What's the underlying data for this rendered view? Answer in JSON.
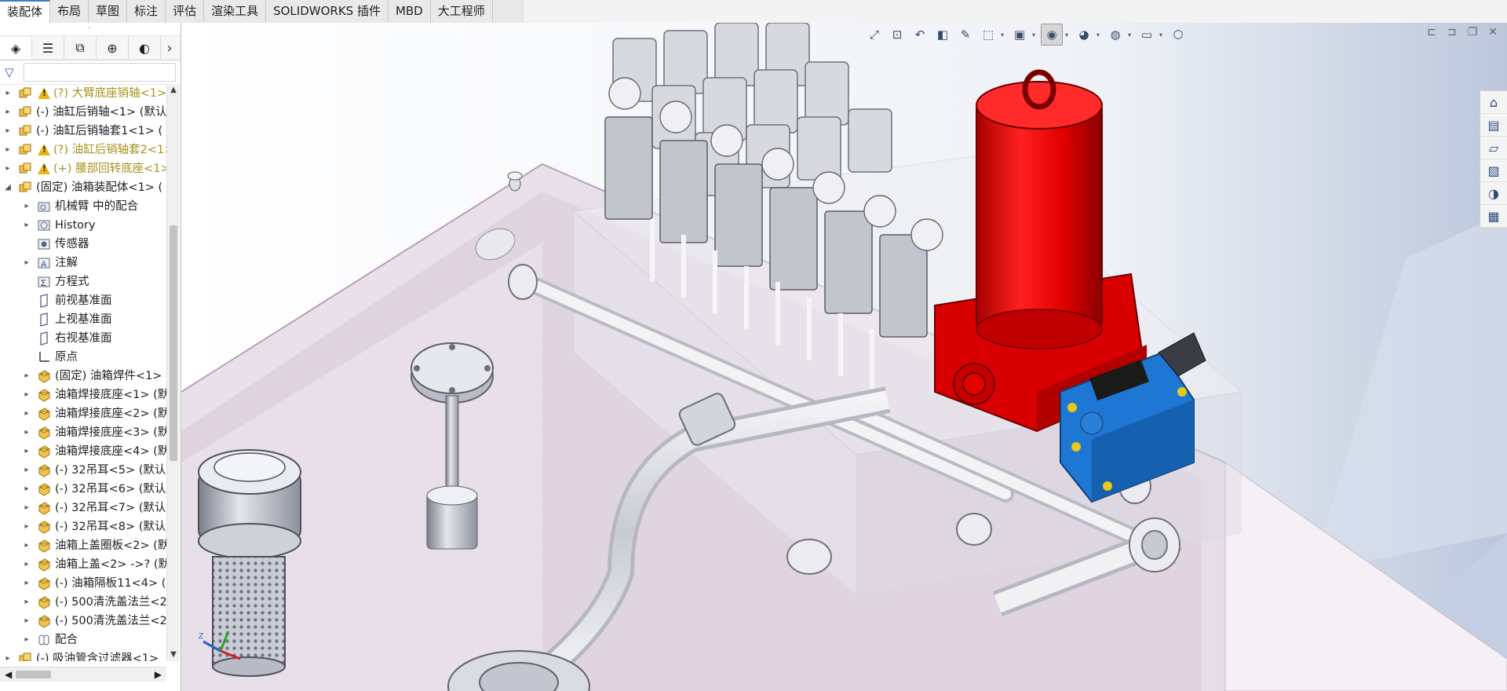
{
  "tabs": [
    {
      "label": "装配体",
      "active": true
    },
    {
      "label": "布局",
      "active": false
    },
    {
      "label": "草图",
      "active": false
    },
    {
      "label": "标注",
      "active": false
    },
    {
      "label": "评估",
      "active": false
    },
    {
      "label": "渲染工具",
      "active": false
    },
    {
      "label": "SOLIDWORKS 插件",
      "active": false
    },
    {
      "label": "MBD",
      "active": false
    },
    {
      "label": "大工程师",
      "active": false
    }
  ],
  "panel_tabs": [
    {
      "icon": "feature-manager-icon",
      "glyph": "◈"
    },
    {
      "icon": "property-manager-icon",
      "glyph": "☰"
    },
    {
      "icon": "configuration-manager-icon",
      "glyph": "⧉"
    },
    {
      "icon": "dimxpert-icon",
      "glyph": "⊕"
    },
    {
      "icon": "display-manager-icon",
      "glyph": "◐"
    }
  ],
  "tree": [
    {
      "level": 0,
      "expand": "right",
      "icon": "assembly-icon",
      "warn": true,
      "text": "(?) 大臂底座销轴<1>",
      "warn_color": true
    },
    {
      "level": 0,
      "expand": "right",
      "icon": "assembly-icon",
      "warn": false,
      "text": "(-) 油缸后销轴<1> (默认",
      "warn_color": false
    },
    {
      "level": 0,
      "expand": "right",
      "icon": "assembly-icon",
      "warn": false,
      "text": "(-) 油缸后销轴套1<1> (",
      "warn_color": false
    },
    {
      "level": 0,
      "expand": "right",
      "icon": "assembly-icon",
      "warn": true,
      "text": "(?) 油缸后销轴套2<1>",
      "warn_color": true
    },
    {
      "level": 0,
      "expand": "right",
      "icon": "assembly-icon",
      "warn": true,
      "text": "(+) 腰部回转底座<1>",
      "warn_color": true
    },
    {
      "level": 0,
      "expand": "down",
      "icon": "assembly-icon",
      "warn": false,
      "text": "(固定) 油箱装配体<1> (",
      "warn_color": false
    },
    {
      "level": 1,
      "expand": "right",
      "icon": "mates-folder-icon",
      "warn": false,
      "text": "机械臂 中的配合",
      "warn_color": false
    },
    {
      "level": 1,
      "expand": "right",
      "icon": "history-icon",
      "warn": false,
      "text": "History",
      "warn_color": false
    },
    {
      "level": 1,
      "expand": "",
      "icon": "sensor-icon",
      "warn": false,
      "text": "传感器",
      "warn_color": false
    },
    {
      "level": 1,
      "expand": "right",
      "icon": "annotation-icon",
      "warn": false,
      "text": "注解",
      "warn_color": false
    },
    {
      "level": 1,
      "expand": "",
      "icon": "equation-icon",
      "warn": false,
      "text": "方程式",
      "warn_color": false
    },
    {
      "level": 1,
      "expand": "",
      "icon": "plane-icon",
      "warn": false,
      "text": "前视基准面",
      "warn_color": false
    },
    {
      "level": 1,
      "expand": "",
      "icon": "plane-icon",
      "warn": false,
      "text": "上视基准面",
      "warn_color": false
    },
    {
      "level": 1,
      "expand": "",
      "icon": "plane-icon",
      "warn": false,
      "text": "右视基准面",
      "warn_color": false
    },
    {
      "level": 1,
      "expand": "",
      "icon": "origin-icon",
      "warn": false,
      "text": "原点",
      "warn_color": false
    },
    {
      "level": 1,
      "expand": "right",
      "icon": "part-icon",
      "warn": false,
      "text": "(固定) 油箱焊件<1> (",
      "warn_color": false
    },
    {
      "level": 1,
      "expand": "right",
      "icon": "part-icon",
      "warn": false,
      "text": "油箱焊接底座<1> (默",
      "warn_color": false
    },
    {
      "level": 1,
      "expand": "right",
      "icon": "part-icon",
      "warn": false,
      "text": "油箱焊接底座<2> (默",
      "warn_color": false
    },
    {
      "level": 1,
      "expand": "right",
      "icon": "part-icon",
      "warn": false,
      "text": "油箱焊接底座<3> (默",
      "warn_color": false
    },
    {
      "level": 1,
      "expand": "right",
      "icon": "part-icon",
      "warn": false,
      "text": "油箱焊接底座<4> (默",
      "warn_color": false
    },
    {
      "level": 1,
      "expand": "right",
      "icon": "part-icon",
      "warn": false,
      "text": "(-) 32吊耳<5> (默认",
      "warn_color": false
    },
    {
      "level": 1,
      "expand": "right",
      "icon": "part-icon",
      "warn": false,
      "text": "(-) 32吊耳<6> (默认",
      "warn_color": false
    },
    {
      "level": 1,
      "expand": "right",
      "icon": "part-icon",
      "warn": false,
      "text": "(-) 32吊耳<7> (默认",
      "warn_color": false
    },
    {
      "level": 1,
      "expand": "right",
      "icon": "part-icon",
      "warn": false,
      "text": "(-) 32吊耳<8> (默认",
      "warn_color": false
    },
    {
      "level": 1,
      "expand": "right",
      "icon": "part-icon",
      "warn": false,
      "text": "油箱上盖圈板<2> (默",
      "warn_color": false
    },
    {
      "level": 1,
      "expand": "right",
      "icon": "part-icon",
      "warn": false,
      "text": "油箱上盖<2> ->? (默",
      "warn_color": false
    },
    {
      "level": 1,
      "expand": "right",
      "icon": "part-icon",
      "warn": false,
      "text": "(-) 油箱隔板11<4> (",
      "warn_color": false
    },
    {
      "level": 1,
      "expand": "right",
      "icon": "part-icon",
      "warn": false,
      "text": "(-) 500清洗盖法兰<2",
      "warn_color": false
    },
    {
      "level": 1,
      "expand": "right",
      "icon": "part-icon",
      "warn": false,
      "text": "(-) 500清洗盖法兰<2",
      "warn_color": false
    },
    {
      "level": 1,
      "expand": "right",
      "icon": "mates-icon",
      "warn": false,
      "text": "配合",
      "warn_color": false
    },
    {
      "level": 0,
      "expand": "right",
      "icon": "assembly-icon",
      "warn": false,
      "text": "(-) 吸油管含过滤器<1>",
      "warn_color": false
    }
  ],
  "hud_icons": [
    "zoom-to-fit-icon",
    "zoom-area-icon",
    "previous-view-icon",
    "section-view-icon",
    "dynamic-annotation-icon",
    "view-orientation-icon",
    "display-style-icon",
    "hide-show-icon",
    "edit-appearance-icon",
    "apply-scene-icon",
    "view-settings-icon",
    "3d-view-icon"
  ],
  "task_pane": [
    "home-icon",
    "resources-icon",
    "design-library-icon",
    "file-explorer-icon",
    "appearances-icon",
    "custom-properties-icon"
  ],
  "colors": {
    "accent": "#3d7cc9",
    "filter_red": "#e01010",
    "valve_blue": "#1e74d0",
    "warn": "#a7921c"
  }
}
